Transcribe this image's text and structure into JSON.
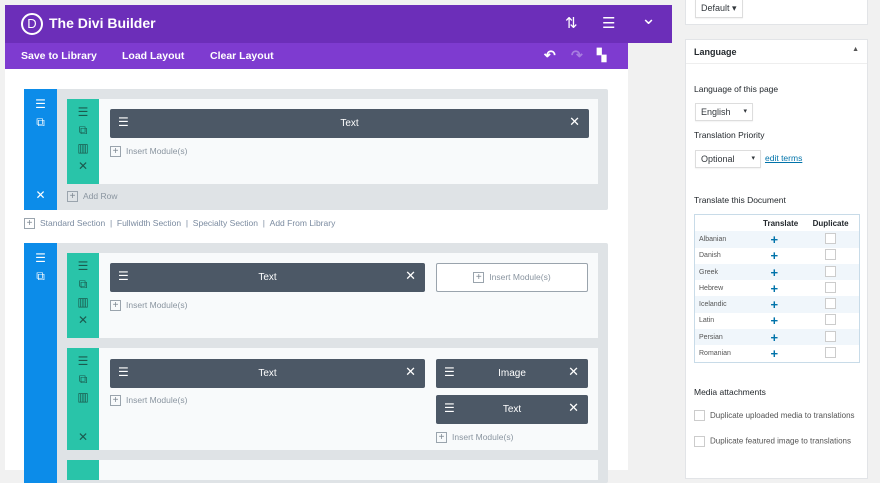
{
  "builder": {
    "logo": "D",
    "title": "The Divi Builder",
    "toolbar": {
      "save": "Save to Library",
      "load": "Load Layout",
      "clear": "Clear Layout"
    }
  },
  "icons": {
    "sort": "⇅",
    "menu": "☰",
    "chevron": "⌄",
    "undo": "↶",
    "redo": "↷",
    "history": "▚",
    "drag": "☰",
    "clone": "⧉",
    "columns": "▥",
    "close": "✕",
    "plus": "+"
  },
  "modules": {
    "text": "Text",
    "image": "Image",
    "insert": "Insert Module(s)",
    "add_row": "Add Row"
  },
  "section_links": [
    "Standard Section",
    "Fullwidth Section",
    "Specialty Section",
    "Add From Library"
  ],
  "sidebar": {
    "default_select": "Default",
    "language": {
      "title": "Language",
      "page_lang_label": "Language of this page",
      "page_lang": "English",
      "priority_label": "Translation Priority",
      "priority": "Optional",
      "edit_terms": "edit terms",
      "translate_doc": "Translate this Document",
      "col_translate": "Translate",
      "col_duplicate": "Duplicate",
      "languages": [
        "Albanian",
        "Danish",
        "Greek",
        "Hebrew",
        "Icelandic",
        "Latin",
        "Persian",
        "Romanian"
      ],
      "media_title": "Media attachments",
      "media_opt1": "Duplicate uploaded media to translations",
      "media_opt2": "Duplicate featured image to translations"
    }
  }
}
